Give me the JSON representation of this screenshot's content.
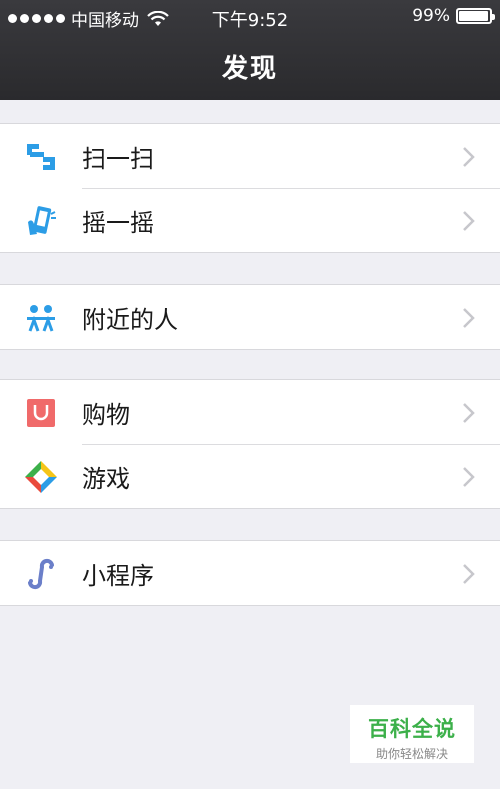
{
  "status_bar": {
    "carrier": "中国移动",
    "time": "下午9:52",
    "battery": "99%",
    "battery_level": 0.99
  },
  "header": {
    "title": "发现"
  },
  "groups": [
    {
      "items": [
        {
          "label": "扫一扫",
          "icon": "scan-icon"
        },
        {
          "label": "摇一摇",
          "icon": "shake-phone-icon"
        }
      ]
    },
    {
      "items": [
        {
          "label": "附近的人",
          "icon": "people-nearby-icon"
        }
      ]
    },
    {
      "items": [
        {
          "label": "购物",
          "icon": "shopping-bag-icon"
        },
        {
          "label": "游戏",
          "icon": "games-icon"
        }
      ]
    },
    {
      "items": [
        {
          "label": "小程序",
          "icon": "mini-program-icon"
        }
      ]
    }
  ],
  "watermark": {
    "title": "百科全说",
    "subtitle": "助你轻松解决"
  },
  "colors": {
    "header_bg": "#2e2e31",
    "page_bg": "#efeff4",
    "scan_blue": "#2c9de6",
    "shop_red": "#f06a6a",
    "mini_program_purple": "#6b7fc9",
    "watermark_green": "#3cb04a"
  }
}
